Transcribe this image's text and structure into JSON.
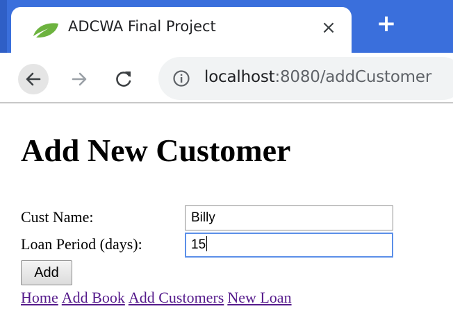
{
  "browser": {
    "tab": {
      "title": "ADCWA Final Project",
      "close_glyph": "×",
      "favicon": "spring-leaf-icon"
    },
    "new_tab_glyph": "+",
    "toolbar": {
      "back_icon": "back-arrow-icon",
      "forward_icon": "forward-arrow-icon",
      "reload_icon": "reload-icon",
      "info_icon": "info-icon"
    },
    "address": {
      "host": "localhost",
      "path": ":8080/addCustomer"
    },
    "colors": {
      "tabstrip": "#3a6fdc",
      "favicon": "#6db33f",
      "focus_ring": "#5b8fe8",
      "visited_link": "#551a8b"
    }
  },
  "page": {
    "title": "Add New Customer",
    "form": {
      "cust_name_label": "Cust Name:",
      "cust_name_value": "Billy",
      "loan_period_label": "Loan Period (days):",
      "loan_period_value": "15",
      "submit_label": "Add"
    },
    "nav": [
      {
        "label": "Home"
      },
      {
        "label": "Add Book"
      },
      {
        "label": "Add Customers"
      },
      {
        "label": "New Loan"
      }
    ]
  }
}
